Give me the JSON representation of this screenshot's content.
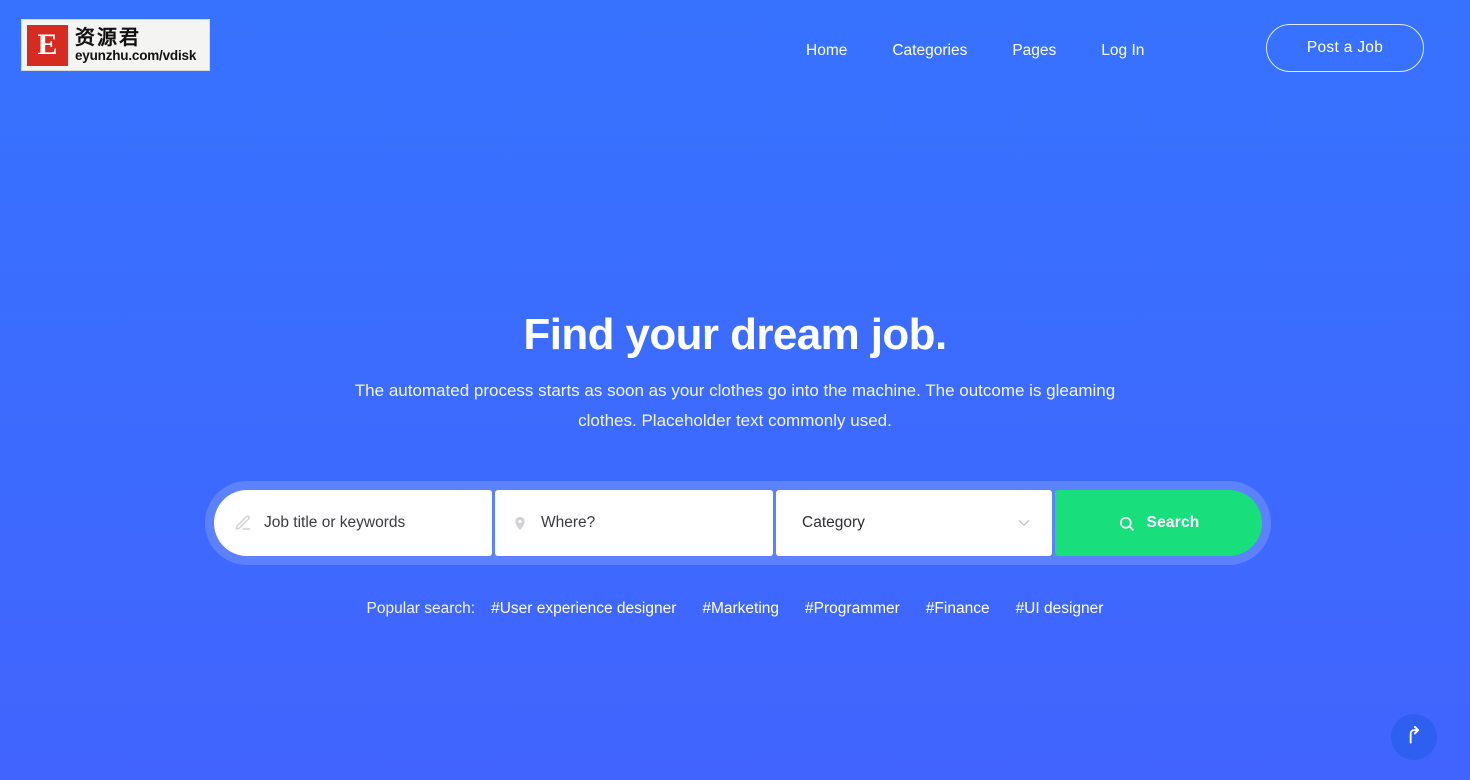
{
  "theme": {
    "bg_top": "#3772FF",
    "bg_bottom": "#4164FE",
    "accent_green": "#18DE7B",
    "text_on_blue": "#FFFFFF"
  },
  "header": {
    "logo": {
      "mark_letter": "E",
      "cn_text": "资源君",
      "url_text": "eyunzhu.com/vdisk"
    },
    "nav": [
      {
        "label": "Home"
      },
      {
        "label": "Categories"
      },
      {
        "label": "Pages"
      },
      {
        "label": "Log In"
      }
    ],
    "cta": {
      "label": "Post a Job"
    }
  },
  "hero": {
    "title": "Find your dream job.",
    "subtitle": "The automated process starts as soon as your clothes go into the machine. The outcome is gleaming clothes. Placeholder text commonly used."
  },
  "search": {
    "keywords": {
      "value": "",
      "placeholder": "Job title or keywords",
      "icon": "pencil-icon"
    },
    "location": {
      "value": "",
      "placeholder": "Where?",
      "icon": "map-pin-icon"
    },
    "category": {
      "selected": "Category",
      "icon": "chevron-down-icon"
    },
    "submit": {
      "label": "Search",
      "icon": "search-icon"
    }
  },
  "popular_search": {
    "label": "Popular search:",
    "tags": [
      "#User experience designer",
      "#Marketing",
      "#Programmer",
      "#Finance",
      "#UI designer"
    ]
  },
  "scroll_top": {
    "icon": "arrow-up-icon"
  }
}
